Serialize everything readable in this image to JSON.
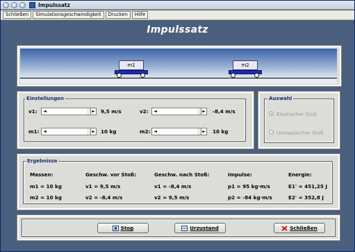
{
  "window": {
    "title": "Impulssatz"
  },
  "menu": [
    "Schließen",
    "Simulationsgeschwindigkeit",
    "Drucken",
    "Hilfe"
  ],
  "heading": "Impulssatz",
  "scene": {
    "car1": "m1",
    "car2": "m2"
  },
  "settings": {
    "title": "Einstellungen",
    "v1_label": "v1:",
    "v1_value": "9,5 m/s",
    "v2_label": "v2:",
    "v2_value": "-8,4 m/s",
    "m1_label": "m1:",
    "m1_value": "10 kg",
    "m2_label": "m2:",
    "m2_value": "10 kg"
  },
  "choice": {
    "title": "Auswahl",
    "option1": "Elastischer Stoß",
    "option2": "Unelastischer Stoß",
    "selected": "option1"
  },
  "results": {
    "title": "Ergebnisse",
    "headers": [
      "Massen:",
      "Geschw. vor Stoß:",
      "Geschw. nach Stoß:",
      "Impulse:",
      "Energie:"
    ],
    "rows": [
      [
        "m1 = 10 kg",
        "v1 = 9,5 m/s",
        "v1 = -8,4 m/s",
        "p1 = 95 kg·m/s",
        "E1' = 451,25 J"
      ],
      [
        "m2 = 10 kg",
        "v2 = -8,4 m/s",
        "v2 = 9,5 m/s",
        "p2 = -84 kg·m/s",
        "E2' = 352,8 J"
      ]
    ]
  },
  "buttons": {
    "stop": "Stop",
    "reset": "Urzustand",
    "close": "Schließen"
  },
  "colors": {
    "background": "#4a5f7e",
    "panel": "#dcdcd9",
    "cart": "#1d2bb5",
    "group_title": "#1b2f6a"
  }
}
